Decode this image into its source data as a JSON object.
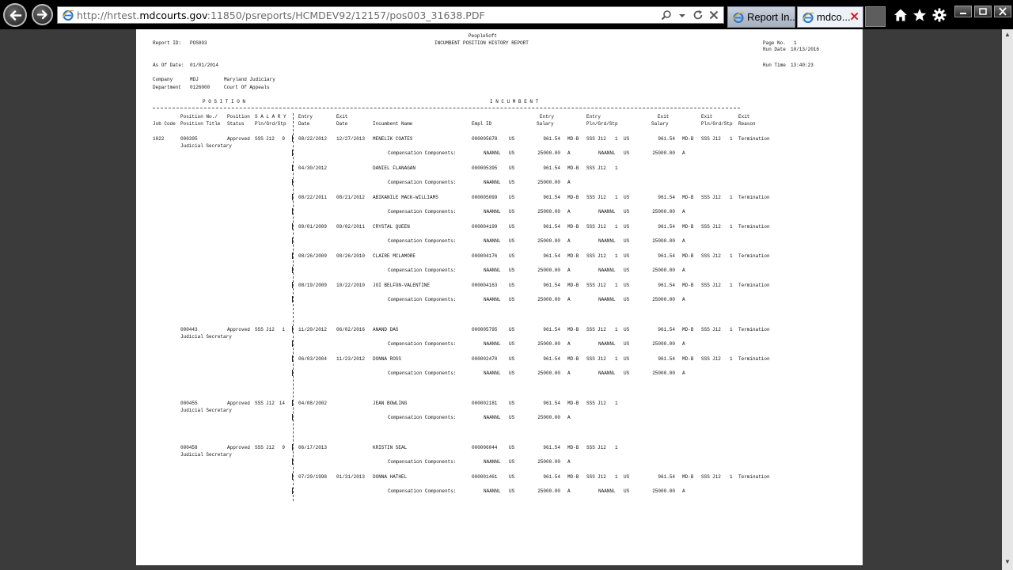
{
  "browser": {
    "url_prefix": "http://hrtest.",
    "url_domain": "mdcourts.gov",
    "url_suffix": ":11850/psreports/HCMDEV92/12157/pos003_31638.PDF",
    "tabs": [
      {
        "label": "Report In..."
      },
      {
        "label": "mdco..."
      }
    ],
    "icons": [
      "back-icon",
      "forward-icon",
      "search-icon",
      "refresh-icon",
      "stop-icon",
      "home-icon",
      "star-icon",
      "gear-icon"
    ]
  },
  "report": {
    "company_name": "PeopleSoft",
    "title": "INCUMBENT POSITION HISTORY REPORT",
    "report_id_label": "Report ID:",
    "report_id": "POS003",
    "page_no_label": "Page No.",
    "page_no": "1",
    "run_date_label": "Run Date",
    "run_date": "10/13/2016",
    "run_time_label": "Run Time",
    "run_time": "13:40:23",
    "as_of_label": "As Of Date:",
    "as_of": "01/01/2014",
    "company_label": "Company",
    "company_code": "MDJ",
    "company_desc": "Maryland Judiciary",
    "department_label": "Department",
    "department_code": "0126000",
    "department_desc": "Court Of Appeals",
    "section_position": "P O S I T I O N",
    "section_incumbent": "I N C U M B E N T",
    "headers": {
      "job_code": [
        "",
        "Job Code"
      ],
      "position_no": [
        "Position No./",
        "Position Title"
      ],
      "position_status": [
        "Position",
        "Status"
      ],
      "salary": [
        "S A L A R Y",
        "Pln/Grd/Stp"
      ],
      "entry_date": [
        "Entry",
        "Date"
      ],
      "exit_date": [
        "Exit",
        "Date"
      ],
      "incumbent_name": [
        "",
        "Incumbent Name"
      ],
      "empl_id": [
        "",
        "Empl ID"
      ],
      "entry_salary": [
        "Entry",
        "Salary"
      ],
      "entry_pln": [
        "Entry",
        "Pln/Grd/Stp"
      ],
      "exit_salary": [
        "Exit",
        "Salary"
      ],
      "exit_pln": [
        "Exit",
        "Pln/Grd/Stp"
      ],
      "exit_reason": [
        "Exit",
        "Reason"
      ]
    },
    "job_code": "1022",
    "positions": [
      {
        "no": "000395",
        "title": "Judicial Secretary",
        "status": "Approved",
        "pln": "SSS",
        "grd": "J12",
        "stp": "9"
      },
      {
        "no": "000443",
        "title": "Judicial Secretary",
        "status": "Approved",
        "pln": "SSS",
        "grd": "J12",
        "stp": "1"
      },
      {
        "no": "000455",
        "title": "Judicial Secretary",
        "status": "Approved",
        "pln": "SSS",
        "grd": "J12",
        "stp": "14"
      },
      {
        "no": "000458",
        "title": "Judicial Secretary",
        "status": "Approved",
        "pln": "SSS",
        "grd": "J12",
        "stp": "9"
      }
    ],
    "comp_label": "Compensation Components:",
    "comp": {
      "code": "NAANNL",
      "curr": "US",
      "amount": "25000.00",
      "flag": "A"
    },
    "incumbents": [
      {
        "entry": "08/22/2012",
        "exit": "12/27/2013",
        "name": "MENELIK COATES",
        "emplid": "000005678",
        "curr": "US",
        "sal": "961.54",
        "loc": "MD-B",
        "pln": "SSS",
        "grd": "J12",
        "stp": "1",
        "xcurr": "US",
        "xsal": "961.54",
        "xloc": "MD-B",
        "xpln": "SSS",
        "xgrd": "J12",
        "xstp": "1",
        "reason": "Termination"
      },
      {
        "entry": "04/30/2012",
        "exit": "",
        "name": "DANIEL FLANAGAN",
        "emplid": "000005395",
        "curr": "US",
        "sal": "961.54",
        "loc": "MD-B",
        "pln": "SSS",
        "grd": "J12",
        "stp": "1",
        "xcurr": "",
        "xsal": "",
        "xloc": "",
        "xpln": "",
        "xgrd": "",
        "xstp": "",
        "reason": ""
      },
      {
        "entry": "08/22/2011",
        "exit": "08/21/2012",
        "name": "ABIKANILE MACK-WILLIAMS",
        "emplid": "000005099",
        "curr": "US",
        "sal": "961.54",
        "loc": "MD-B",
        "pln": "SSS",
        "grd": "J12",
        "stp": "1",
        "xcurr": "US",
        "xsal": "961.54",
        "xloc": "MD-B",
        "xpln": "SSS",
        "xgrd": "J12",
        "xstp": "1",
        "reason": "Termination"
      },
      {
        "entry": "09/01/2009",
        "exit": "09/02/2011",
        "name": "CRYSTAL QUEEN",
        "emplid": "000004199",
        "curr": "US",
        "sal": "961.54",
        "loc": "MD-B",
        "pln": "SSS",
        "grd": "J12",
        "stp": "1",
        "xcurr": "US",
        "xsal": "961.54",
        "xloc": "MD-B",
        "xpln": "SSS",
        "xgrd": "J12",
        "xstp": "1",
        "reason": "Termination"
      },
      {
        "entry": "08/26/2009",
        "exit": "08/26/2010",
        "name": "CLAIRE MCLAMORE",
        "emplid": "000004176",
        "curr": "US",
        "sal": "961.54",
        "loc": "MD-B",
        "pln": "SSS",
        "grd": "J12",
        "stp": "1",
        "xcurr": "US",
        "xsal": "961.54",
        "xloc": "MD-B",
        "xpln": "SSS",
        "xgrd": "J12",
        "xstp": "1",
        "reason": "Termination"
      },
      {
        "entry": "08/19/2009",
        "exit": "10/22/2010",
        "name": "JOI BELFON-VALENTINE",
        "emplid": "000004163",
        "curr": "US",
        "sal": "961.54",
        "loc": "MD-B",
        "pln": "SSS",
        "grd": "J12",
        "stp": "1",
        "xcurr": "US",
        "xsal": "961.54",
        "xloc": "MD-B",
        "xpln": "SSS",
        "xgrd": "J12",
        "xstp": "1",
        "reason": "Termination"
      },
      {
        "entry": "11/20/2012",
        "exit": "06/02/2016",
        "name": "ANAND DAS",
        "emplid": "000005795",
        "curr": "US",
        "sal": "961.54",
        "loc": "MD-B",
        "pln": "SSS",
        "grd": "J12",
        "stp": "1",
        "xcurr": "US",
        "xsal": "961.54",
        "xloc": "MD-B",
        "xpln": "SSS",
        "xgrd": "J12",
        "xstp": "1",
        "reason": "Termination"
      },
      {
        "entry": "06/03/2004",
        "exit": "11/23/2012",
        "name": "DONNA ROSS",
        "emplid": "000002470",
        "curr": "US",
        "sal": "961.54",
        "loc": "MD-B",
        "pln": "SSS",
        "grd": "J12",
        "stp": "1",
        "xcurr": "US",
        "xsal": "961.54",
        "xloc": "MD-B",
        "xpln": "SSS",
        "xgrd": "J12",
        "xstp": "1",
        "reason": "Termination"
      },
      {
        "entry": "04/08/2002",
        "exit": "",
        "name": "JEAN BOWLING",
        "emplid": "000002181",
        "curr": "US",
        "sal": "961.54",
        "loc": "MD-B",
        "pln": "SSS",
        "grd": "J12",
        "stp": "1",
        "xcurr": "",
        "xsal": "",
        "xloc": "",
        "xpln": "",
        "xgrd": "",
        "xstp": "",
        "reason": ""
      },
      {
        "entry": "06/17/2013",
        "exit": "",
        "name": "KRISTIN SEAL",
        "emplid": "000006044",
        "curr": "US",
        "sal": "961.54",
        "loc": "MD-B",
        "pln": "SSS",
        "grd": "J12",
        "stp": "1",
        "xcurr": "",
        "xsal": "",
        "xloc": "",
        "xpln": "",
        "xgrd": "",
        "xstp": "",
        "reason": ""
      },
      {
        "entry": "07/29/1998",
        "exit": "01/31/2013",
        "name": "DONNA HATHEL",
        "emplid": "000001461",
        "curr": "US",
        "sal": "961.54",
        "loc": "MD-B",
        "pln": "SSS",
        "grd": "J12",
        "stp": "1",
        "xcurr": "US",
        "xsal": "961.54",
        "xloc": "MD-B",
        "xpln": "SSS",
        "xgrd": "J12",
        "xstp": "1",
        "reason": "Termination"
      }
    ]
  }
}
